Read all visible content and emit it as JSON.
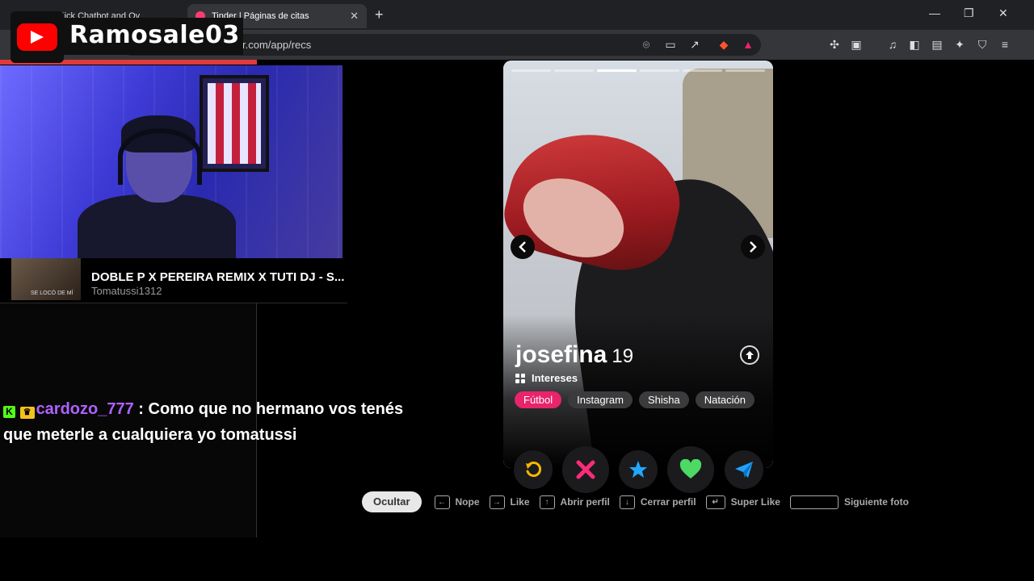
{
  "browser": {
    "tabs": [
      {
        "title": "t.app - Kick Chatbot and Ov",
        "active": false
      },
      {
        "title": "Tinder | Páginas de citas",
        "active": true
      }
    ],
    "new_tab": "+",
    "url": "r.com/app/recs",
    "window_controls": {
      "minimize": "—",
      "restore": "❐",
      "close": "✕"
    }
  },
  "overlay": {
    "channel_name": "Ramosale03",
    "brand_color": "#ff0000"
  },
  "music": {
    "album_caption": "SE LOCÓ DE MÍ",
    "song": "DOBLE P X PEREIRA REMIX X TUTI DJ - S...",
    "artist": "Tomatussi1312"
  },
  "chat": {
    "badge_k": "K",
    "username": "cardozo_777",
    "separator": " : ",
    "message": "Como que no hermano vos tenés que meterle a cualquiera yo tomatussi",
    "username_color": "#b061ff"
  },
  "profile": {
    "name": "josefina",
    "age": "19",
    "interests_label": "Intereses",
    "interests": [
      {
        "label": "Fútbol",
        "highlighted": true
      },
      {
        "label": "Instagram",
        "highlighted": false
      },
      {
        "label": "Shisha",
        "highlighted": false
      },
      {
        "label": "Natación",
        "highlighted": false
      }
    ],
    "photo_count": 6,
    "current_photo": 3,
    "accent_color": "#e8246a"
  },
  "actions": [
    {
      "icon": "rewind-icon",
      "color": "#f5b700"
    },
    {
      "icon": "nope-x-icon",
      "color": "#ff2b79"
    },
    {
      "icon": "super-like-star-icon",
      "color": "#22a7ff"
    },
    {
      "icon": "like-heart-icon",
      "color": "#4cd964"
    },
    {
      "icon": "boost-send-icon",
      "color": "#1fa2ff"
    }
  ],
  "hints": {
    "hide": "Ocultar",
    "nope": "Nope",
    "like": "Like",
    "open_profile": "Abrir perfil",
    "close_profile": "Cerrar perfil",
    "super_like": "Super Like",
    "next_photo": "Siguiente foto"
  }
}
